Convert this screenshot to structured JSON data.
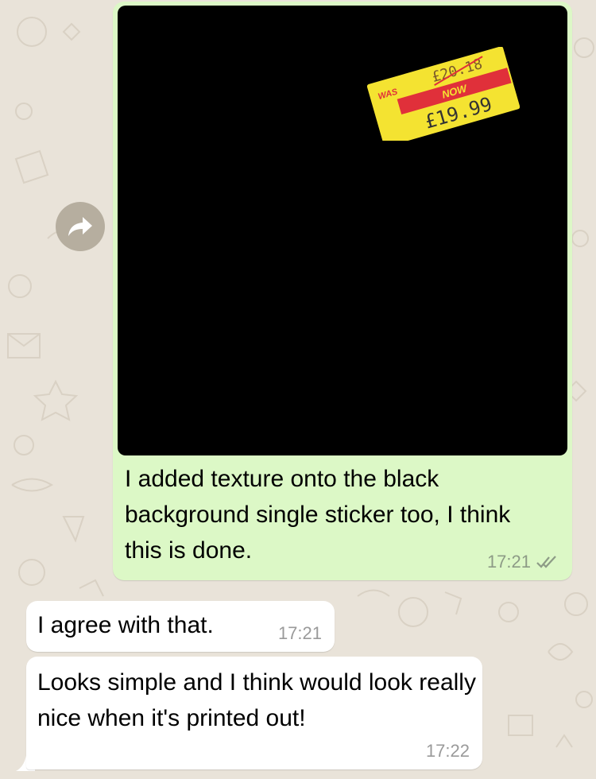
{
  "chat": {
    "messages": [
      {
        "direction": "outgoing",
        "type": "image",
        "text": "I added texture onto the black background single sticker too, I think this is done.",
        "time": "17:21",
        "status_icon": "double-check-icon",
        "sticker": {
          "was_label": "WAS",
          "old_price": "£20.18",
          "now_label": "NOW",
          "new_price": "£19.99"
        }
      },
      {
        "direction": "incoming",
        "text": "I agree with that.",
        "time": "17:21"
      },
      {
        "direction": "incoming",
        "text": "Looks simple and I think would look really nice when it's printed out!",
        "time": "17:22"
      }
    ],
    "forward_icon": "forward-arrow-icon"
  },
  "colors": {
    "wallpaper": "#e9e3d9",
    "outgoing_bubble": "#dcf8c6",
    "incoming_bubble": "#ffffff",
    "sticker_yellow": "#f4e331",
    "sticker_red": "#e0303a"
  }
}
